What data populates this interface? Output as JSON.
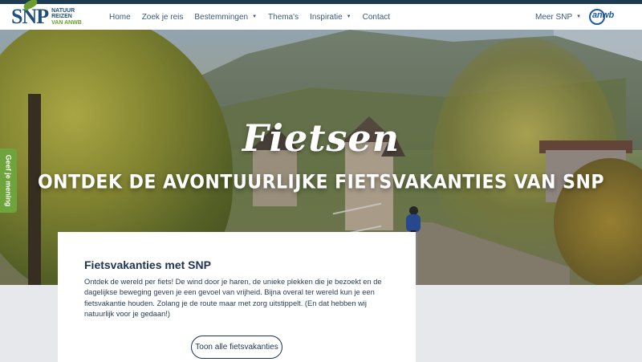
{
  "logo": {
    "brand": "SNP",
    "line1": "NATUUR",
    "line2": "REIZEN",
    "line3": "VAN ANWB"
  },
  "nav": {
    "items": [
      {
        "label": "Home",
        "has_dropdown": false
      },
      {
        "label": "Zoek je reis",
        "has_dropdown": false
      },
      {
        "label": "Bestemmingen",
        "has_dropdown": true
      },
      {
        "label": "Thema's",
        "has_dropdown": false
      },
      {
        "label": "Inspiratie",
        "has_dropdown": true
      },
      {
        "label": "Contact",
        "has_dropdown": false
      }
    ],
    "meer": "Meer SNP",
    "partner_logo": "anwb"
  },
  "hero": {
    "title": "Fietsen",
    "subtitle": "ONTDEK DE AVONTUURLIJKE FIETSVAKANTIES VAN SNP"
  },
  "feedback": {
    "label": "Geef je mening"
  },
  "card": {
    "title": "Fietsvakanties met SNP",
    "text": "Ontdek de wereld per fiets! De wind door je haren, de unieke plekken die je bezoekt en de dagelijkse beweging geven je een gevoel van vrijheid. Bijna overal ter wereld kun je een fietsvakantie houden. Zolang je de route maar met zorg uitstippelt. (En dat hebben wij natuurlijk voor je gedaan!)",
    "button": "Toon alle fietsvakanties"
  },
  "colors": {
    "nav_text": "#3a5a78",
    "brand_blue": "#1f4f7b",
    "brand_green": "#6a9e2f",
    "feedback_green": "#6fa33b",
    "dark_navy": "#1c3a52"
  },
  "icons": {
    "dropdown": "caret-down-icon"
  }
}
